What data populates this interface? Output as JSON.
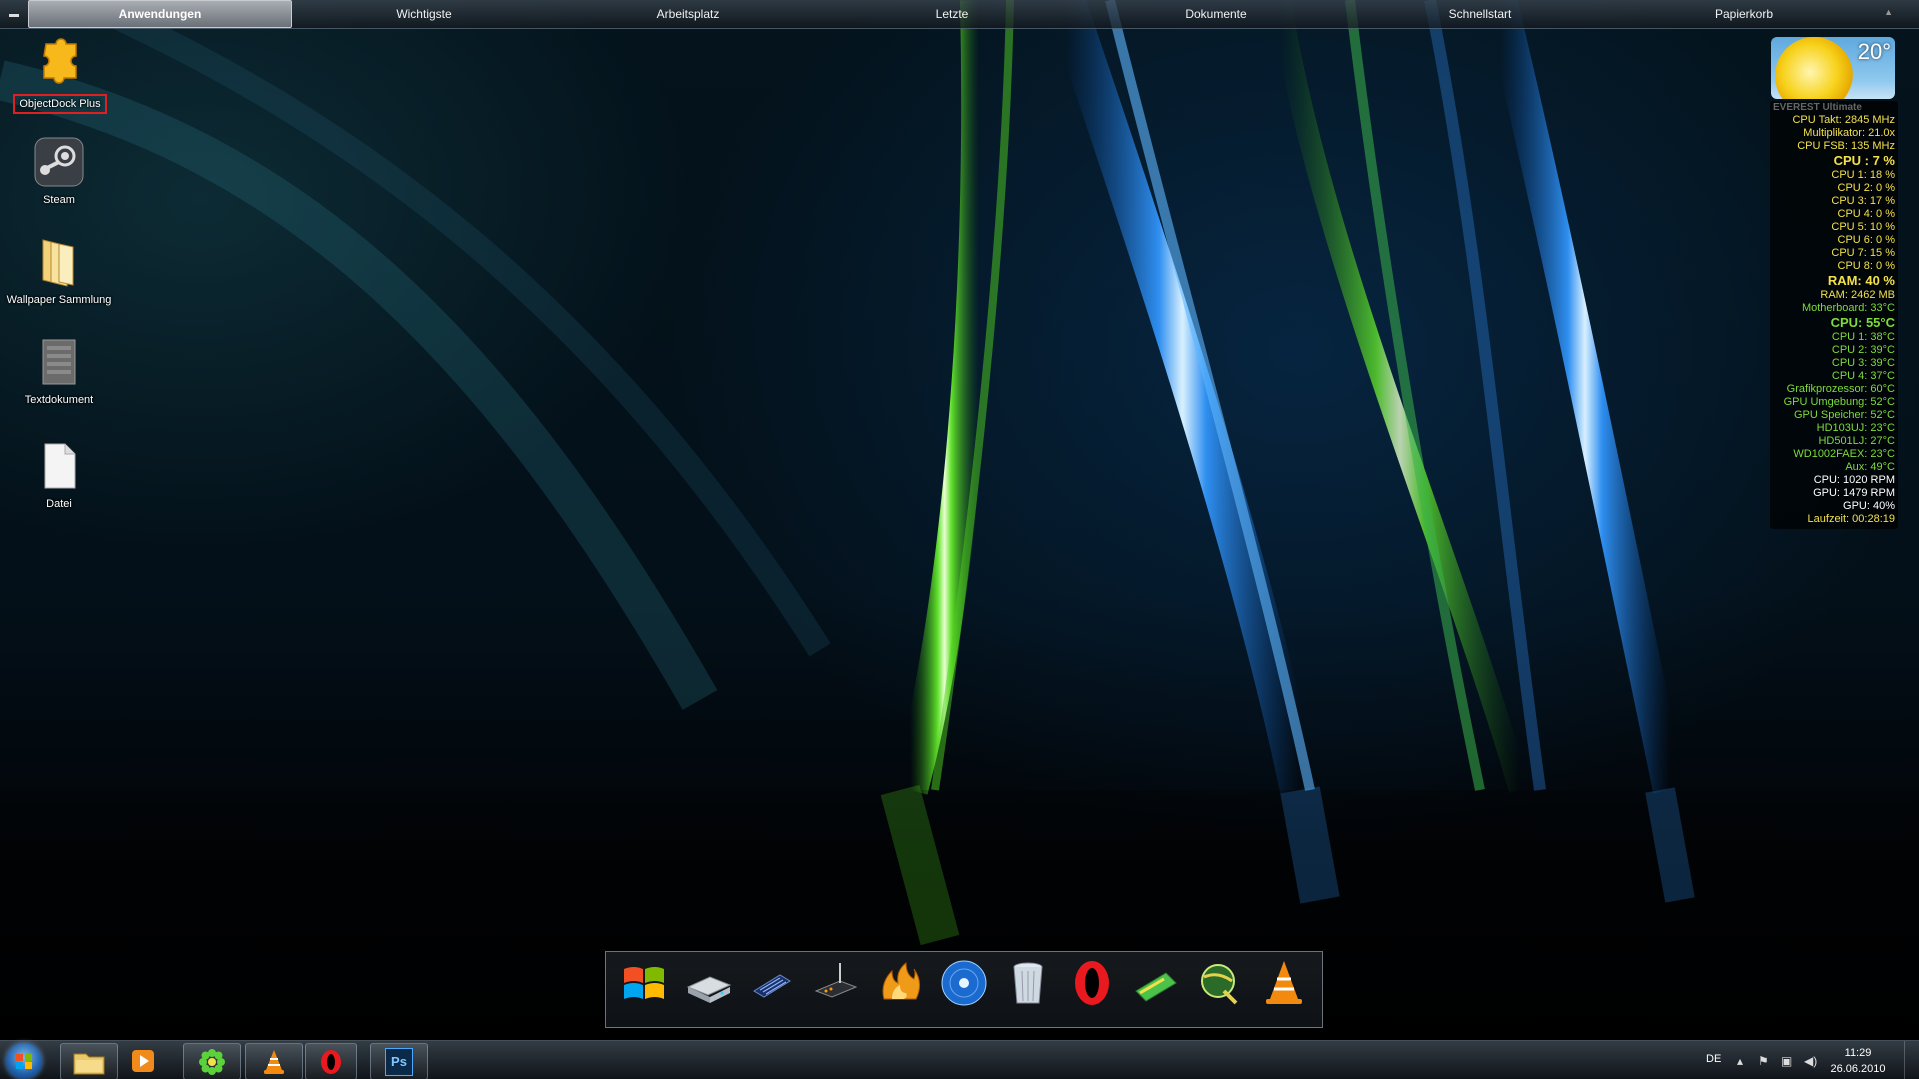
{
  "topbar": {
    "tabs": [
      {
        "label": "Anwendungen",
        "active": true
      },
      {
        "label": "Wichtigste"
      },
      {
        "label": "Arbeitsplatz"
      },
      {
        "label": "Letzte"
      },
      {
        "label": "Dokumente"
      },
      {
        "label": "Schnellstart"
      },
      {
        "label": "Papierkorb"
      }
    ]
  },
  "desktop": {
    "icons": [
      {
        "label": "ObjectDock Plus",
        "icon": "puzzle-icon",
        "selected": true
      },
      {
        "label": "Steam",
        "icon": "steam-icon"
      },
      {
        "label": "Wallpaper Sammlung",
        "icon": "folder-icon"
      },
      {
        "label": "Textdokument",
        "icon": "zip-icon"
      },
      {
        "label": "Datei",
        "icon": "text-file-icon"
      }
    ]
  },
  "weather": {
    "temperature": "20°"
  },
  "everest": {
    "title": "EVEREST Ultimate",
    "rows": [
      {
        "text": "CPU Takt: 2845 MHz",
        "color": "#f3e14b"
      },
      {
        "text": "Multiplikator: 21.0x",
        "color": "#f3e14b"
      },
      {
        "text": "CPU FSB: 135 MHz",
        "color": "#f3e14b"
      },
      {
        "text": "CPU : 7 %",
        "color": "#f3e14b",
        "big": true
      },
      {
        "text": "CPU 1: 18 %",
        "color": "#f3e14b"
      },
      {
        "text": "CPU 2: 0 %",
        "color": "#f3e14b"
      },
      {
        "text": "CPU 3: 17 %",
        "color": "#f3e14b"
      },
      {
        "text": "CPU 4: 0 %",
        "color": "#f3e14b"
      },
      {
        "text": "CPU 5: 10 %",
        "color": "#f3e14b"
      },
      {
        "text": "CPU 6: 0 %",
        "color": "#f3e14b"
      },
      {
        "text": "CPU 7: 15 %",
        "color": "#f3e14b"
      },
      {
        "text": "CPU 8: 0 %",
        "color": "#f3e14b"
      },
      {
        "text": "RAM: 40 %",
        "color": "#f3e14b",
        "big": true
      },
      {
        "text": "RAM: 2462 MB",
        "color": "#f3e14b"
      },
      {
        "text": "Motherboard: 33°C",
        "color": "#7ddc3a"
      },
      {
        "text": "CPU: 55°C",
        "color": "#7ddc3a",
        "big": true
      },
      {
        "text": "CPU 1: 38°C",
        "color": "#7ddc3a"
      },
      {
        "text": "CPU 2: 39°C",
        "color": "#7ddc3a"
      },
      {
        "text": "CPU 3: 39°C",
        "color": "#7ddc3a"
      },
      {
        "text": "CPU 4: 37°C",
        "color": "#7ddc3a"
      },
      {
        "text": "Grafikprozessor: 60°C",
        "color": "#7ddc3a"
      },
      {
        "text": "GPU Umgebung: 52°C",
        "color": "#7ddc3a"
      },
      {
        "text": "GPU Speicher: 52°C",
        "color": "#7ddc3a"
      },
      {
        "text": "HD103UJ: 23°C",
        "color": "#7ddc3a"
      },
      {
        "text": "HD501LJ: 27°C",
        "color": "#7ddc3a"
      },
      {
        "text": "WD1002FAEX: 23°C",
        "color": "#7ddc3a"
      },
      {
        "text": "Aux: 49°C",
        "color": "#7ddc3a"
      },
      {
        "text": "CPU: 1020 RPM",
        "color": "#ffffff"
      },
      {
        "text": "GPU: 1479 RPM",
        "color": "#ffffff"
      },
      {
        "text": "GPU: 40%",
        "color": "#ffffff"
      },
      {
        "text": "Laufzeit: 00:28:19",
        "color": "#f3e14b"
      }
    ]
  },
  "dock": {
    "items": [
      "windows-flag-icon",
      "drive-icon",
      "blue-device-icon",
      "router-icon",
      "fire-icon",
      "dvd-icon",
      "recycle-bin-icon",
      "opera-icon",
      "green-card-icon",
      "globe-icon",
      "vlc-icon"
    ]
  },
  "taskbar": {
    "buttons": [
      "explorer-icon",
      "media-player-icon",
      "icq-icon",
      "vlc-icon",
      "opera-icon",
      "photoshop-icon"
    ],
    "photoshop_label": "Ps",
    "language": "DE",
    "time": "11:29",
    "date": "26.06.2010"
  }
}
